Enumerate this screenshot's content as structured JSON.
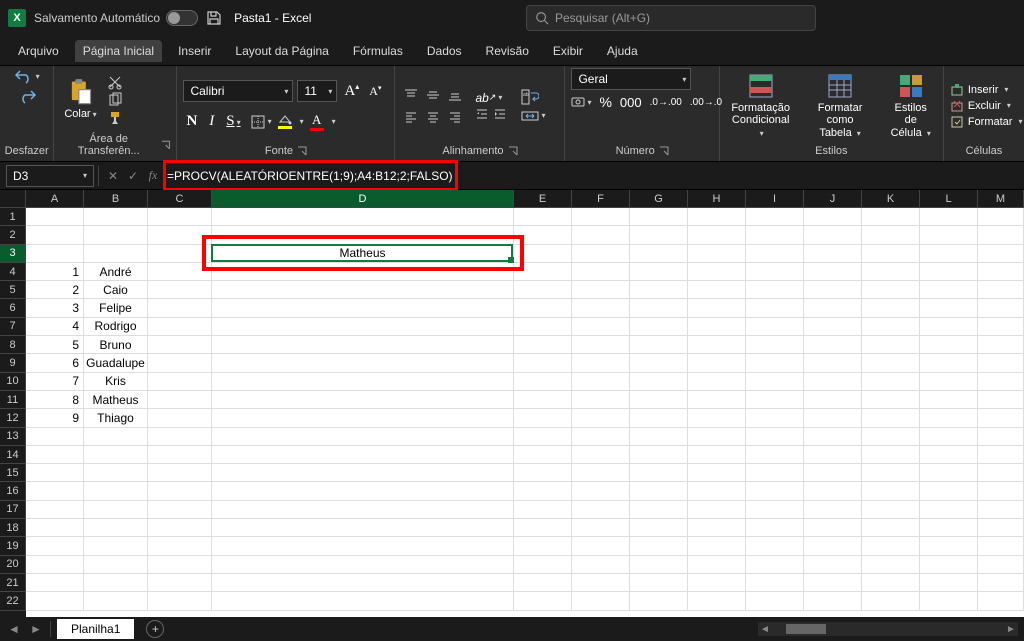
{
  "titlebar": {
    "autosave_label": "Salvamento Automático",
    "doc_title": "Pasta1 - Excel",
    "search_placeholder": "Pesquisar (Alt+G)"
  },
  "tabs": {
    "items": [
      "Arquivo",
      "Página Inicial",
      "Inserir",
      "Layout da Página",
      "Fórmulas",
      "Dados",
      "Revisão",
      "Exibir",
      "Ajuda"
    ],
    "active_index": 1
  },
  "ribbon": {
    "undo_group": "Desfazer",
    "clipboard_group": "Área de Transferên...",
    "paste_label": "Colar",
    "font_group": "Fonte",
    "font_name": "Calibri",
    "font_size": "11",
    "alignment_group": "Alinhamento",
    "number_group": "Número",
    "number_format": "Geral",
    "styles_group": "Estilos",
    "cond_fmt_label": "Formatação\nCondicional",
    "table_fmt_label": "Formatar como\nTabela",
    "cell_styles_label": "Estilos de\nCélula",
    "cells_group": "Células",
    "insert_label": "Inserir",
    "delete_label": "Excluir",
    "format_label": "Formatar"
  },
  "formula_bar": {
    "cell_ref": "D3",
    "formula": "=PROCV(ALEATÓRIOENTRE(1;9);A4:B12;2;FALSO)"
  },
  "sheet": {
    "columns": [
      "A",
      "B",
      "C",
      "D",
      "E",
      "F",
      "G",
      "H",
      "I",
      "J",
      "K",
      "L",
      "M"
    ],
    "active_col_index": 3,
    "active_row": 3,
    "d3_value": "Matheus",
    "data_rows": [
      {
        "a": "1",
        "b": "André"
      },
      {
        "a": "2",
        "b": "Caio"
      },
      {
        "a": "3",
        "b": "Felipe"
      },
      {
        "a": "4",
        "b": "Rodrigo"
      },
      {
        "a": "5",
        "b": "Bruno"
      },
      {
        "a": "6",
        "b": "Guadalupe"
      },
      {
        "a": "7",
        "b": "Kris"
      },
      {
        "a": "8",
        "b": "Matheus"
      },
      {
        "a": "9",
        "b": "Thiago"
      }
    ],
    "row_count": 22
  },
  "sheet_tabs": {
    "active": "Planilha1"
  }
}
